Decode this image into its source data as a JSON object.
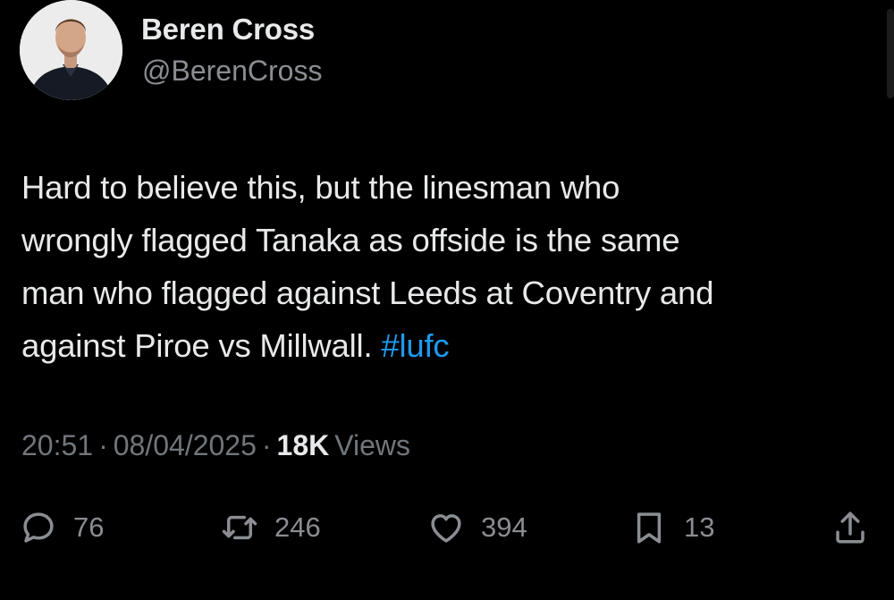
{
  "author": {
    "display_name": "Beren Cross",
    "handle": "@BerenCross"
  },
  "tweet": {
    "lines": [
      "Hard to believe this, but the linesman who",
      "wrongly flagged Tanaka as offside is the same",
      "man who flagged against Leeds at Coventry and",
      "against Piroe vs Millwall."
    ],
    "hashtag": "#lufc"
  },
  "meta": {
    "time": "20:51",
    "separator": "·",
    "date": "08/04/2025",
    "views_count": "18K",
    "views_label": "Views"
  },
  "actions": {
    "reply": {
      "icon": "reply-icon",
      "count": "76"
    },
    "retweet": {
      "icon": "retweet-icon",
      "count": "246"
    },
    "like": {
      "icon": "heart-icon",
      "count": "394"
    },
    "bookmark": {
      "icon": "bookmark-icon",
      "count": "13"
    },
    "share": {
      "icon": "share-icon"
    }
  },
  "colors": {
    "background": "#000000",
    "text_primary": "#e7e9ea",
    "text_secondary": "#71767b",
    "link": "#1d9bf0"
  }
}
